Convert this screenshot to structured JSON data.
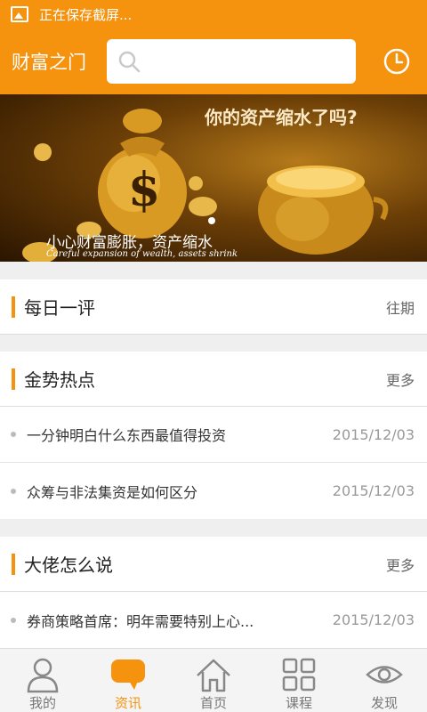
{
  "status": {
    "text": "正在保存截屏..."
  },
  "header": {
    "title": "财富之门",
    "search_placeholder": ""
  },
  "banner": {
    "headline": "你的资产缩水了吗?",
    "subtitle_cn": "小心财富膨胀，资产缩水",
    "subtitle_en": "Careful expansion of wealth, assets shrink"
  },
  "daily": {
    "title": "每日一评",
    "more": "往期"
  },
  "hot": {
    "title": "金势热点",
    "more": "更多",
    "items": [
      {
        "text": "一分钟明白什么东西最值得投资",
        "date": "2015/12/03"
      },
      {
        "text": "众筹与非法集资是如何区分",
        "date": "2015/12/03"
      }
    ]
  },
  "experts": {
    "title": "大佬怎么说",
    "more": "更多",
    "items": [
      {
        "text": "券商策略首席：明年需要特别上心...",
        "date": "2015/12/03"
      }
    ]
  },
  "tabs": [
    {
      "label": "我的",
      "icon": "person-icon"
    },
    {
      "label": "资讯",
      "icon": "chat-icon"
    },
    {
      "label": "首页",
      "icon": "home-icon"
    },
    {
      "label": "课程",
      "icon": "grid-icon"
    },
    {
      "label": "发现",
      "icon": "eye-icon"
    }
  ],
  "colors": {
    "accent": "#f5920e",
    "background": "#efefef"
  },
  "active_tab": "资讯"
}
